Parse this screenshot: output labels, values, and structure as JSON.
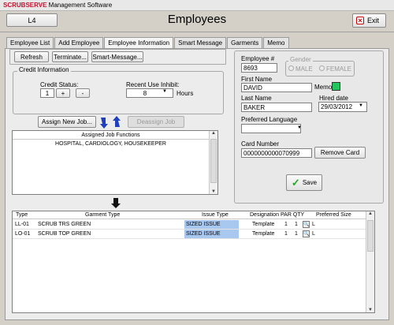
{
  "app": {
    "brand_part1": "SCRUB",
    "brand_part2": "SERVE",
    "brand_rest": " Management Software",
    "location_code": "L4",
    "page_title": "Employees",
    "exit_label": "Exit"
  },
  "tabs": [
    {
      "label": "Employee List"
    },
    {
      "label": "Add Employee"
    },
    {
      "label": "Employee Information"
    },
    {
      "label": "Smart Message"
    },
    {
      "label": "Garments"
    },
    {
      "label": "Memo"
    }
  ],
  "toolbar": {
    "refresh_label": "Refresh",
    "terminate_label": "Terminate...",
    "smart_message_label": "Smart-Message..."
  },
  "credit": {
    "group_title": "Credit Information",
    "credit_status_label": "Credit Status:",
    "credit_status_value": "1",
    "plus_label": "+",
    "minus_label": "-",
    "inhibit_label": "Recent Use Inhibit:",
    "inhibit_value": "8",
    "hours_label": "Hours"
  },
  "jobs": {
    "assign_label": "Assign New Job...",
    "deassign_label": "Deassign Job",
    "table_header": "Assigned Job Functions",
    "rows": [
      "HOSPITAL, CARDIOLOGY, HOUSEKEEPER"
    ]
  },
  "employee": {
    "number_label": "Employee #",
    "number_value": "8693",
    "gender_label": "Gender",
    "male_label": "MALE",
    "female_label": "FEMALE",
    "first_name_label": "First Name",
    "first_name_value": "DAVID",
    "memo_label": "Memo",
    "memo_color": "#22c55e",
    "last_name_label": "Last Name",
    "last_name_value": "BAKER",
    "hired_label": "Hired date",
    "hired_value": "29/03/2012",
    "language_label": "Preferred Language",
    "language_value": "",
    "card_label": "Card Number",
    "card_value": "0000000000070999",
    "remove_card_label": "Remove Card",
    "save_label": "Save"
  },
  "garments": {
    "headers": {
      "type": "Type",
      "garment_type": "Garment Type",
      "issue_type": "Issue Type",
      "designation": "Designation",
      "par_qty": "PAR QTY",
      "preferred_size": "Preferred Size"
    },
    "rows": [
      {
        "type": "LL-01",
        "garment": "SCRUB TRS GREEN",
        "issue": "SIZED ISSUE",
        "designation": "Template",
        "par": "1",
        "qty": "1",
        "size": "L"
      },
      {
        "type": "LO-01",
        "garment": "SCRUB TOP GREEN",
        "issue": "SIZED ISSUE",
        "designation": "Template",
        "par": "1",
        "qty": "1",
        "size": "L"
      }
    ],
    "issue_highlight_color": "#a9c8f0"
  },
  "icons": {
    "exit": "close-x-icon",
    "save": "checkmark-icon",
    "assign_arrows": "transfer-arrows-icon",
    "down_arrow": "down-arrow-icon",
    "search": "magnifier-icon"
  }
}
